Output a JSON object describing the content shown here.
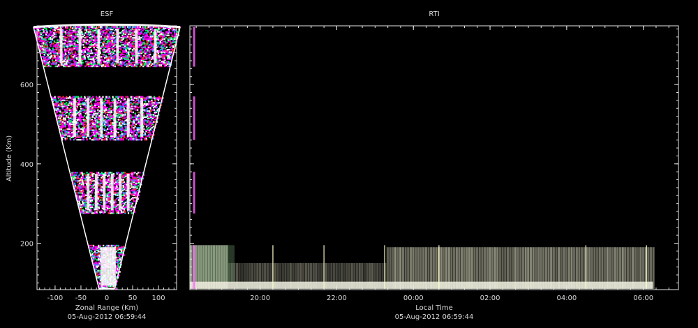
{
  "chart_data": [
    {
      "type": "heatmap",
      "title": "ESF",
      "xlabel": "Zonal Range (Km)",
      "ylabel": "Altitude (Km)",
      "timestamp": "05-Aug-2012 06:59:44",
      "xlim": [
        -135,
        135
      ],
      "ylim": [
        83,
        748
      ],
      "x_ticks": [
        -100,
        -50,
        0,
        50,
        100
      ],
      "x_tick_labels": [
        "-100",
        "-50",
        "0",
        "50",
        "100"
      ],
      "y_ticks": [
        200,
        400,
        600
      ],
      "y_tick_labels": [
        "200",
        "400",
        "600"
      ],
      "grid": false,
      "sector_half_angle_deg": 10,
      "echo_layers_altitude_km": [
        {
          "bottom": 85,
          "top": 195
        },
        {
          "bottom": 275,
          "top": 380
        },
        {
          "bottom": 460,
          "top": 570
        },
        {
          "bottom": 645,
          "top": 745
        }
      ],
      "colors": {
        "echo_primary": "#ff00ff",
        "echo_core": "#ffffff",
        "sector_outline": "#ffffff"
      }
    },
    {
      "type": "heatmap",
      "title": "RTI",
      "xlabel": "Local Time",
      "ylabel": "",
      "timestamp": "05-Aug-2012 06:59:44",
      "xlim": [
        "18:10",
        "06:55"
      ],
      "ylim": [
        83,
        748
      ],
      "x_tick_labels": [
        "20:00",
        "22:00",
        "00:00",
        "02:00",
        "04:00",
        "06:00"
      ],
      "y_ticks": [
        200,
        400,
        600
      ],
      "grid": false,
      "echo_band_altitude_km": [
        85,
        195
      ],
      "echo_band_time": [
        "18:10",
        "06:15"
      ],
      "vertical_trace_times": [
        "20:20",
        "21:40",
        "23:15",
        "00:40",
        "04:30",
        "06:05"
      ],
      "colors": {
        "echo_band": "#c8c8b0",
        "echo_low": "#f0f0e0",
        "background": "#000000"
      }
    }
  ]
}
